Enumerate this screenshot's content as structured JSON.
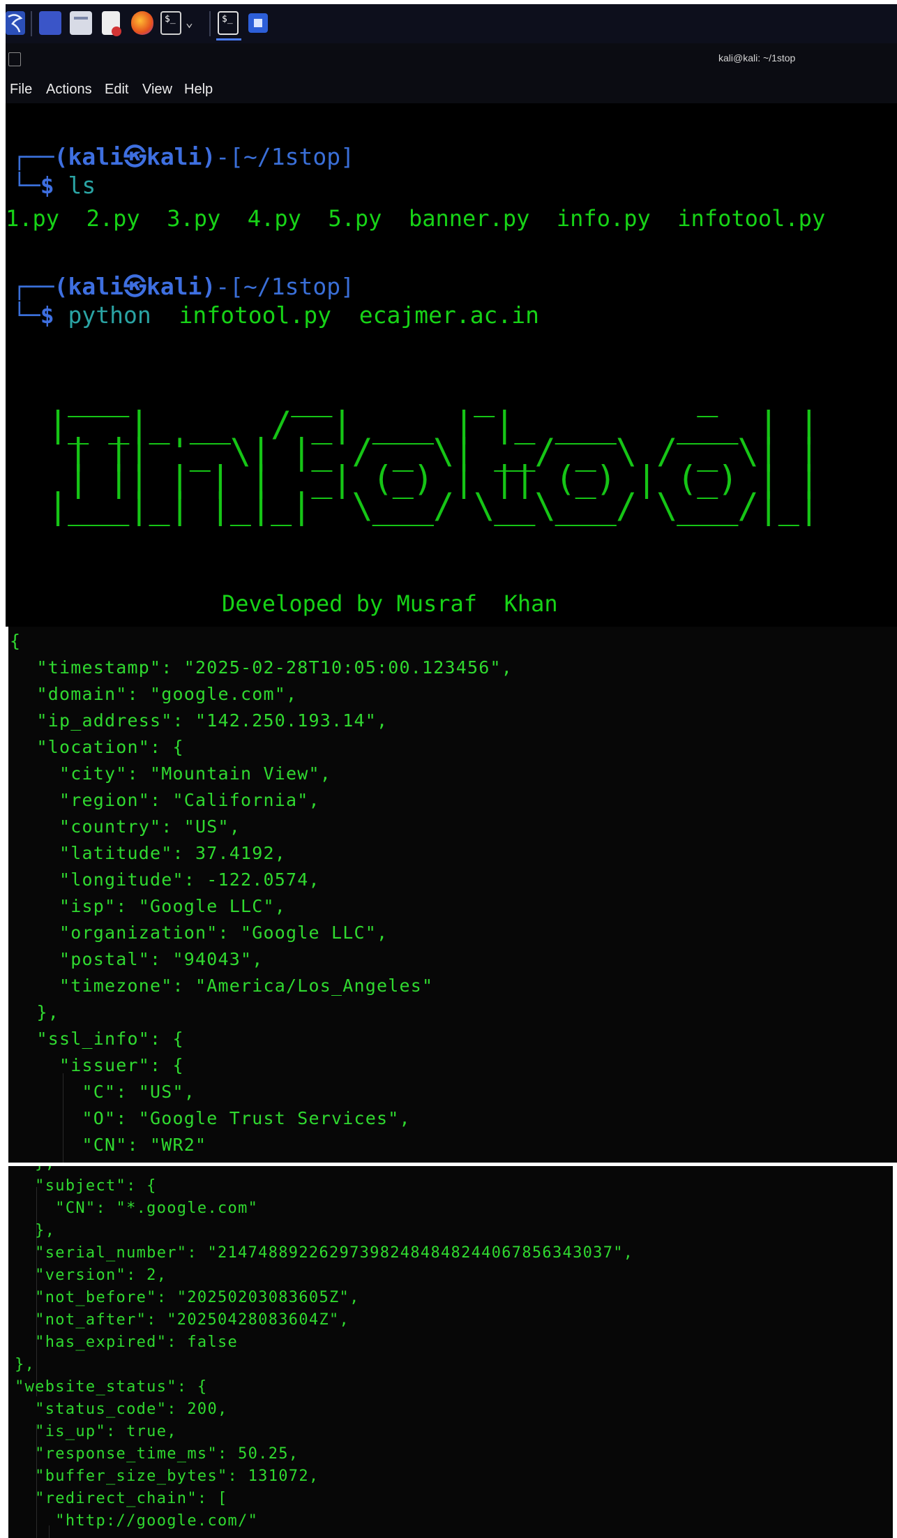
{
  "taskbar": {
    "icons": [
      "kali-menu-icon",
      "workspace-icon",
      "file-manager-icon",
      "text-editor-icon",
      "firefox-icon",
      "terminal-icon",
      "dropdown-icon",
      "terminal-active-icon",
      "app-icon"
    ]
  },
  "window": {
    "title": "kali@kali: ~/1stop"
  },
  "menu": {
    "file": "File",
    "actions": "Actions",
    "edit": "Edit",
    "view": "View",
    "help": "Help"
  },
  "terminal": {
    "prompt1_user": "(kali㉿kali)",
    "prompt1_dir": "[~/1stop]",
    "cmd1": "ls",
    "ls_output": "1.py  2.py  3.py  4.py  5.py  banner.py  info.py  infotool.py",
    "prompt2_user": "(kali㉿kali)",
    "prompt2_dir": "[~/1stop]",
    "cmd2_prog": "python",
    "cmd2_args": "infotool.py  ecajmer.ac.in",
    "banner_ascii": " ___        __       _          _ \n|_ _|_ __  / _| ___ | |_ ___   ___ | |\n | || '_ \\| |_ / _ \\| __/ _ \\ / _ \\| |\n | || | | |  _| (_) | || (_) | (_) | |\n|___|_| |_|_|  \\___/ \\__\\___/ \\___/|_|",
    "developed_by": "Developed by Musraf  Khan"
  },
  "json_panel_1": [
    "{",
    "  \"timestamp\": \"2025-02-28T10:05:00.123456\",",
    "  \"domain\": \"google.com\",",
    "  \"ip_address\": \"142.250.193.14\",",
    "  \"location\": {",
    "    \"city\": \"Mountain View\",",
    "    \"region\": \"California\",",
    "    \"country\": \"US\",",
    "    \"latitude\": 37.4192,",
    "    \"longitude\": -122.0574,",
    "    \"isp\": \"Google LLC\",",
    "    \"organization\": \"Google LLC\",",
    "    \"postal\": \"94043\",",
    "    \"timezone\": \"America/Los_Angeles\"",
    "  },",
    "  \"ssl_info\": {",
    "    \"issuer\": {",
    "      \"C\": \"US\",",
    "      \"O\": \"Google Trust Services\",",
    "      \"CN\": \"WR2\""
  ],
  "json_panel_2": [
    "    },",
    "    \"subject\": {",
    "      \"CN\": \"*.google.com\"",
    "    },",
    "    \"serial_number\": \"214748892262973982484848244067856343037\",",
    "    \"version\": 2,",
    "    \"not_before\": \"20250203083605Z\",",
    "    \"not_after\": \"20250428083604Z\",",
    "    \"has_expired\": false",
    "  },",
    "  \"website_status\": {",
    "    \"status_code\": 200,",
    "    \"is_up\": true,",
    "    \"response_time_ms\": 50.25,",
    "    \"buffer_size_bytes\": 131072,",
    "    \"redirect_chain\": [",
    "      \"http://google.com/\""
  ],
  "colors": {
    "prompt_blue": "#3a6fd8",
    "terminal_green": "#17d317",
    "command_teal": "#2aa3a3",
    "json_green": "#30d930"
  }
}
